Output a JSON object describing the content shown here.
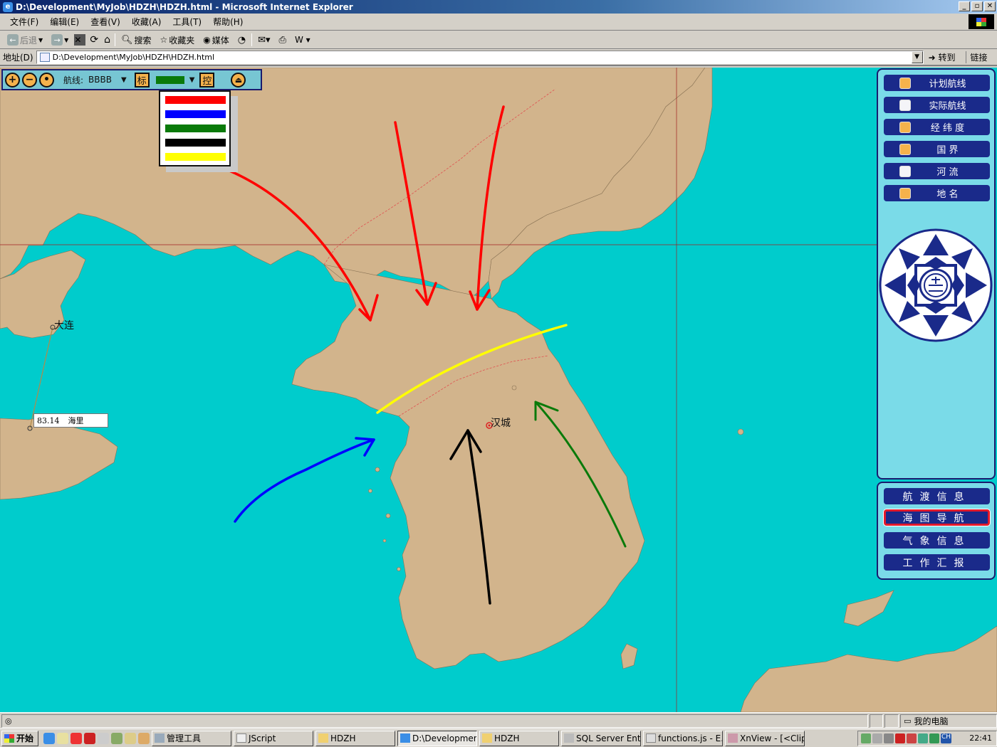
{
  "window": {
    "title": "D:\\Development\\MyJob\\HDZH\\HDZH.html - Microsoft Internet Explorer",
    "min": "_",
    "max": "▫",
    "close": "✕"
  },
  "menu": [
    "文件(F)",
    "编辑(E)",
    "查看(V)",
    "收藏(A)",
    "工具(T)",
    "帮助(H)"
  ],
  "toolbar": {
    "back": "后退",
    "search": "搜索",
    "favorites": "收藏夹",
    "media": "媒体"
  },
  "address": {
    "label": "地址(D)",
    "url": "D:\\Development\\MyJob\\HDZH\\HDZH.html",
    "go": "转到",
    "links": "链接"
  },
  "map_toolbar": {
    "zoom_in": "+",
    "zoom_out": "−",
    "center": "•",
    "route_label": "航线:",
    "route_value": "BBBB",
    "mark_button": "标",
    "selected_color": "#0a7a0a",
    "control_button": "控",
    "eject": "⏏"
  },
  "color_options": [
    "#ff0000",
    "#0000ff",
    "#0a7a0a",
    "#000000",
    "#ffff00"
  ],
  "map": {
    "city_dalian": "大连",
    "city_seoul": "汉城",
    "distance_value": "83.14",
    "distance_unit": "海里"
  },
  "layers": [
    {
      "label": "计划航线",
      "checked": true
    },
    {
      "label": "实际航线",
      "checked": false
    },
    {
      "label": "经 纬 度",
      "checked": true
    },
    {
      "label": "国 界",
      "checked": true
    },
    {
      "label": "河 流",
      "checked": false
    },
    {
      "label": "地 名",
      "checked": true
    }
  ],
  "nav": [
    {
      "label": "航渡信息",
      "active": false
    },
    {
      "label": "海图导航",
      "active": true
    },
    {
      "label": "气象信息",
      "active": false
    },
    {
      "label": "工作汇报",
      "active": false
    }
  ],
  "status": {
    "zone": "我的电脑"
  },
  "taskbar": {
    "start": "开始",
    "tasks": [
      {
        "label": "管理工具",
        "pressed": false
      },
      {
        "label": "JScript",
        "pressed": false
      },
      {
        "label": "HDZH",
        "pressed": false
      },
      {
        "label": "D:\\Developmen...",
        "pressed": true
      },
      {
        "label": "HDZH",
        "pressed": false
      },
      {
        "label": "SQL Server Ent...",
        "pressed": false
      },
      {
        "label": "functions.js - E...",
        "pressed": false
      },
      {
        "label": "XnView - [<Clip...",
        "pressed": false
      }
    ],
    "clock": "22:41",
    "ime": "CH"
  }
}
